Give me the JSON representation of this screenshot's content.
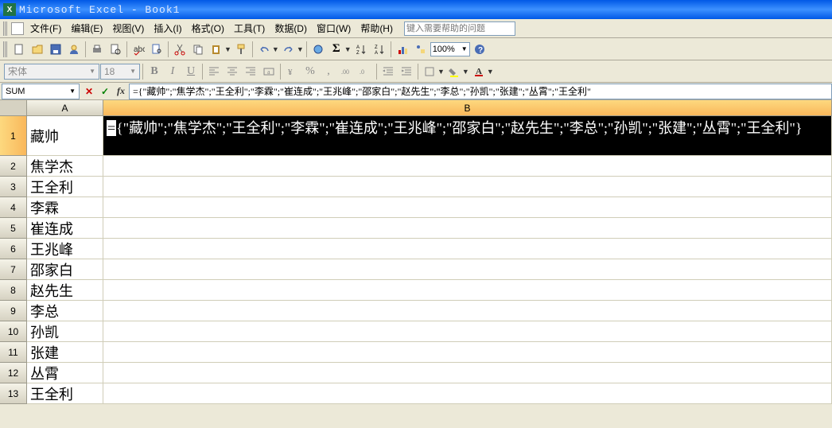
{
  "window": {
    "title": "Microsoft Excel - Book1"
  },
  "menu": {
    "file": "文件(F)",
    "edit": "编辑(E)",
    "view": "视图(V)",
    "insert": "插入(I)",
    "format": "格式(O)",
    "tools": "工具(T)",
    "data": "数据(D)",
    "window": "窗口(W)",
    "help": "帮助(H)",
    "help_placeholder": "键入需要帮助的问题"
  },
  "toolbar": {
    "zoom": "100%"
  },
  "format": {
    "font": "宋体",
    "size": "18"
  },
  "formula_bar": {
    "name_box": "SUM",
    "formula": "={\"藏帅\";\"焦学杰\";\"王全利\";\"李霖\";\"崔连成\";\"王兆峰\";\"邵家白\";\"赵先生\";\"李总\";\"孙凯\";\"张建\";\"丛霄\";\"王全利\""
  },
  "columns": {
    "A": "A",
    "B": "B"
  },
  "rows": {
    "r1": "1",
    "r2": "2",
    "r3": "3",
    "r4": "4",
    "r5": "5",
    "r6": "6",
    "r7": "7",
    "r8": "8",
    "r9": "9",
    "r10": "10",
    "r11": "11",
    "r12": "12",
    "r13": "13"
  },
  "cells": {
    "A1": "藏帅",
    "A2": "焦学杰",
    "A3": "王全利",
    "A4": "李霖",
    "A5": "崔连成",
    "A6": "王兆峰",
    "A7": "邵家白",
    "A8": "赵先生",
    "A9": "李总",
    "A10": "孙凯",
    "A11": "张建",
    "A12": "丛霄",
    "A13": "王全利",
    "B1_eq": "=",
    "B1": "{\"藏帅\";\"焦学杰\";\"王全利\";\"李霖\";\"崔连成\";\"王兆峰\";\"邵家白\";\"赵先生\";\"李总\";\"孙凯\";\"张建\";\"丛霄\";\"王全利\"}"
  }
}
